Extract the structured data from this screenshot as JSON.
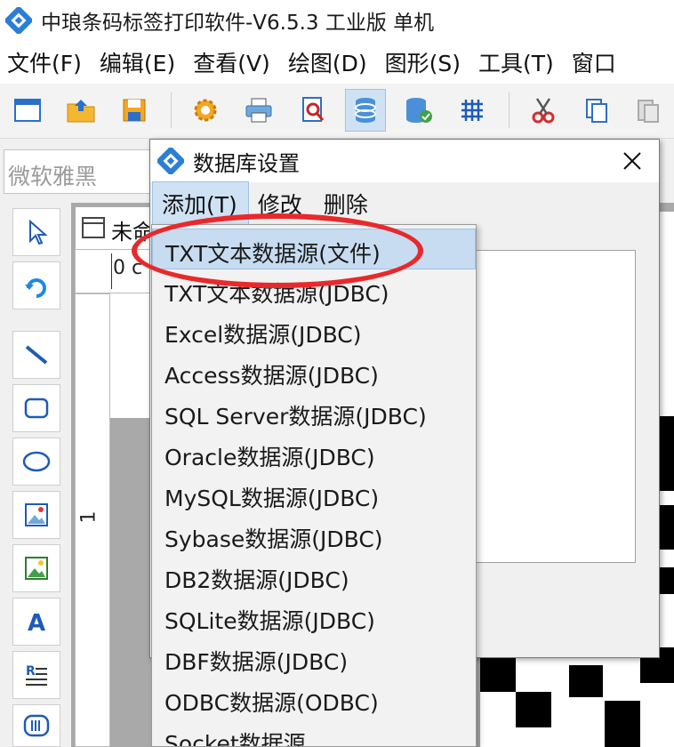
{
  "window": {
    "title": "中琅条码标签打印软件-V6.5.3 工业版 单机"
  },
  "menubar": {
    "items": [
      "文件(F)",
      "编辑(E)",
      "查看(V)",
      "绘图(D)",
      "图形(S)",
      "工具(T)",
      "窗口"
    ]
  },
  "toolbar": {
    "active_button": "database-settings"
  },
  "font_select": {
    "value": "微软雅黑"
  },
  "doc_tab": {
    "label": "未命"
  },
  "ruler": {
    "top_label": "0 c",
    "left_label": "1"
  },
  "dialog": {
    "title": "数据库设置",
    "menu": [
      "添加(T)",
      "修改",
      "删除"
    ]
  },
  "dropdown": {
    "items": [
      "TXT文本数据源(文件)",
      "TXT文本数据源(JDBC)",
      "Excel数据源(JDBC)",
      "Access数据源(JDBC)",
      "SQL Server数据源(JDBC)",
      "Oracle数据源(JDBC)",
      "MySQL数据源(JDBC)",
      "Sybase数据源(JDBC)",
      "DB2数据源(JDBC)",
      "SQLite数据源(JDBC)",
      "DBF数据源(JDBC)",
      "ODBC数据源(ODBC)",
      "Socket数据源"
    ],
    "highlighted_index": 0
  },
  "colors": {
    "highlight": "#c7dcf0",
    "annotation": "#e8292b",
    "accent_blue": "#1e5bb8"
  }
}
